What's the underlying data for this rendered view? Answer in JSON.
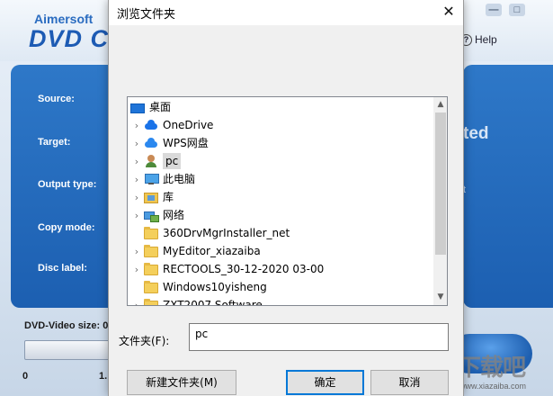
{
  "app": {
    "brand_small": "Aimersoft",
    "brand_big": "DVD C",
    "window_buttons": [
      "—",
      "□"
    ],
    "help_label": "Help",
    "fields": [
      "Source:",
      "Target:",
      "Output type:",
      "Copy mode:",
      "Disc label:"
    ],
    "right_text": "ted",
    "right_text2": "t",
    "dvd_size_label": "DVD-Video size: 0",
    "tick_start": "0",
    "tick_end": "1."
  },
  "dialog": {
    "title": "浏览文件夹",
    "close_glyph": "✕",
    "tree": [
      {
        "label": "桌面",
        "icon": "desktop-icon",
        "expandable": false,
        "indent": 0
      },
      {
        "label": "OneDrive",
        "icon": "onedrive-icon",
        "expandable": true,
        "indent": 1
      },
      {
        "label": "WPS网盘",
        "icon": "wps-cloud-icon",
        "expandable": true,
        "indent": 1
      },
      {
        "label": "pc",
        "icon": "user-folder-icon",
        "expandable": true,
        "indent": 1,
        "selected": true
      },
      {
        "label": "此电脑",
        "icon": "this-pc-icon",
        "expandable": true,
        "indent": 1
      },
      {
        "label": "库",
        "icon": "library-icon",
        "expandable": true,
        "indent": 1
      },
      {
        "label": "网络",
        "icon": "network-icon",
        "expandable": true,
        "indent": 1
      },
      {
        "label": "360DrvMgrInstaller_net",
        "icon": "folder-icon",
        "expandable": false,
        "indent": 1
      },
      {
        "label": "MyEditor_xiazaiba",
        "icon": "folder-icon",
        "expandable": true,
        "indent": 1
      },
      {
        "label": "RECTOOLS_30-12-2020 03-00",
        "icon": "folder-icon",
        "expandable": true,
        "indent": 1
      },
      {
        "label": "Windows10yisheng",
        "icon": "folder-icon",
        "expandable": false,
        "indent": 1
      },
      {
        "label": "ZXT2007 Software",
        "icon": "folder-icon",
        "expandable": true,
        "indent": 1
      }
    ],
    "folder_label": "文件夹(F):",
    "folder_value": "pc",
    "buttons": {
      "new_folder": "新建文件夹(M)",
      "ok": "确定",
      "cancel": "取消"
    }
  },
  "watermark": {
    "mark": "下载吧",
    "url": "www.xiazaiba.com"
  }
}
